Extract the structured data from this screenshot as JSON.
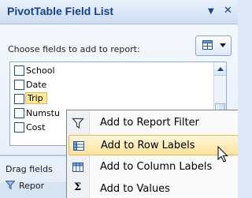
{
  "panel": {
    "title": "PivotTable Field List",
    "dropdown_glyph": "▼",
    "close_glyph": "✕"
  },
  "upper": {
    "instruction": "Choose fields to add to report:",
    "layout_button_icon": "field-list-layout-icon"
  },
  "fields": [
    {
      "label": "School",
      "checked": false,
      "selected": false
    },
    {
      "label": "Date",
      "checked": false,
      "selected": false
    },
    {
      "label": "Trip",
      "checked": false,
      "selected": true
    },
    {
      "label": "Numstu",
      "checked": false,
      "selected": false
    },
    {
      "label": "Cost",
      "checked": false,
      "selected": false
    }
  ],
  "lower": {
    "drag_text": "Drag fields",
    "report_filter_label": "Repor"
  },
  "context_menu": {
    "items": [
      {
        "label": "Add to Report Filter",
        "icon": "filter-icon",
        "hover": false
      },
      {
        "label": "Add to Row Labels",
        "icon": "row-labels-icon",
        "hover": true
      },
      {
        "label": "Add to Column Labels",
        "icon": "column-labels-icon",
        "hover": false
      },
      {
        "label": "Add to Values",
        "icon": "sigma-icon",
        "glyph": "Σ",
        "hover": false
      }
    ]
  },
  "colors": {
    "title_text": "#15428b",
    "hover_fill": "#ffe39d",
    "hover_border": "#e8b84f",
    "selection_fill": "#fde8a2"
  }
}
